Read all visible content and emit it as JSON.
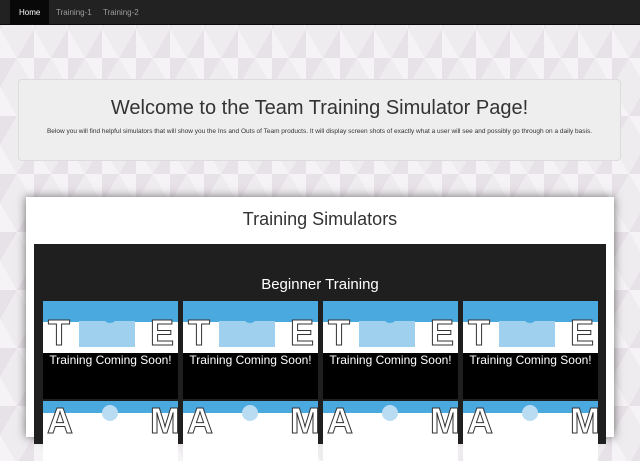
{
  "nav": {
    "items": [
      {
        "label": "Home",
        "active": true
      },
      {
        "label": "Training-1",
        "active": false
      },
      {
        "label": "Training-2",
        "active": false
      }
    ]
  },
  "jumbotron": {
    "title": "Welcome to the Team Training Simulator Page!",
    "text": "Below you will find helpful simulators that will show you the Ins and Outs of Team products. It will display screen shots of exactly what a user will see and possibly go through on a daily basis."
  },
  "panel": {
    "title": "Training Simulators",
    "section_title": "Beginner Training"
  },
  "cards": [
    {
      "top_left": "T",
      "top_right": "E",
      "caption": "Training Coming Soon!",
      "bottom_left": "A",
      "bottom_right": "M"
    },
    {
      "top_left": "T",
      "top_right": "E",
      "caption": "Training Coming Soon!",
      "bottom_left": "A",
      "bottom_right": "M"
    },
    {
      "top_left": "T",
      "top_right": "E",
      "caption": "Training Coming Soon!",
      "bottom_left": "A",
      "bottom_right": "M"
    },
    {
      "top_left": "T",
      "top_right": "E",
      "caption": "Training Coming Soon!",
      "bottom_left": "A",
      "bottom_right": "M"
    }
  ],
  "colors": {
    "navbar": "#222222",
    "puzzle_blue": "#4aa9df",
    "dark_box": "#1f1f1f"
  }
}
